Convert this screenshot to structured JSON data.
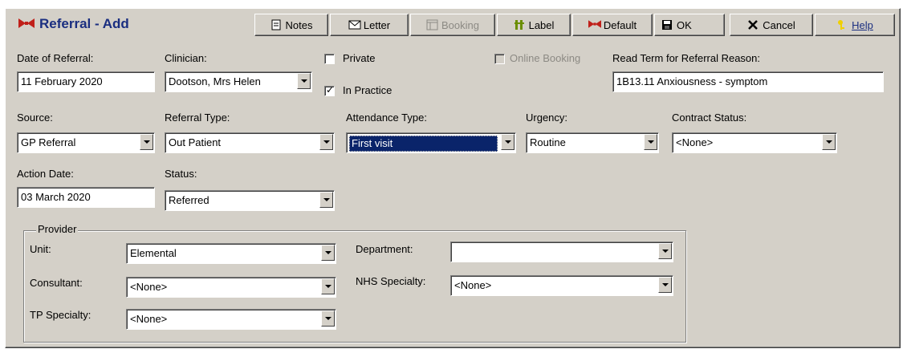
{
  "window": {
    "title": "Referral - Add"
  },
  "toolbar": {
    "notes": "Notes",
    "letter": "Letter",
    "booking": "Booking",
    "label": "Label",
    "default": "Default",
    "ok": "OK",
    "cancel": "Cancel",
    "help": "Help"
  },
  "form": {
    "date_of_referral": {
      "label": "Date of Referral:",
      "value": "11 February 2020"
    },
    "clinician": {
      "label": "Clinician:",
      "value": "Dootson, Mrs Helen"
    },
    "private": {
      "label": "Private",
      "checked": false
    },
    "in_practice": {
      "label": "In Practice",
      "checked": true
    },
    "online_booking": {
      "label": "Online Booking",
      "checked": false,
      "disabled": true
    },
    "read_term": {
      "label": "Read Term for Referral Reason:",
      "value": "1B13.11    Anxiousness - symptom"
    },
    "source": {
      "label": "Source:",
      "value": "GP Referral"
    },
    "referral_type": {
      "label": "Referral Type:",
      "value": "Out Patient"
    },
    "attendance_type": {
      "label": "Attendance Type:",
      "value": "First visit"
    },
    "urgency": {
      "label": "Urgency:",
      "value": "Routine"
    },
    "contract_status": {
      "label": "Contract Status:",
      "value": "<None>"
    },
    "action_date": {
      "label": "Action Date:",
      "value": "03 March 2020"
    },
    "status": {
      "label": "Status:",
      "value": "Referred"
    }
  },
  "provider": {
    "legend": "Provider",
    "unit": {
      "label": "Unit:",
      "value": "Elemental"
    },
    "department": {
      "label": "Department:",
      "value": ""
    },
    "consultant": {
      "label": "Consultant:",
      "value": "<None>"
    },
    "nhs_specialty": {
      "label": "NHS Specialty:",
      "value": "<None>"
    },
    "tp_specialty": {
      "label": "TP Specialty:",
      "value": "<None>"
    }
  },
  "colors": {
    "face": "#d4d0c8",
    "title_text": "#1a2e80",
    "selection": "#0a246a"
  }
}
